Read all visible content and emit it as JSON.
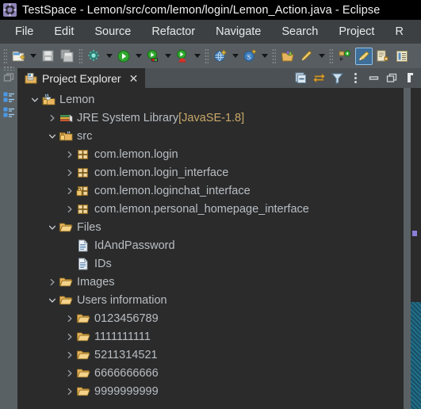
{
  "window": {
    "title": "TestSpace - Lemon/src/com/lemon/login/Lemon_Action.java - Eclipse",
    "app_icon": "eclipse-icon"
  },
  "menubar": {
    "items": [
      {
        "label": "File"
      },
      {
        "label": "Edit"
      },
      {
        "label": "Source"
      },
      {
        "label": "Refactor"
      },
      {
        "label": "Navigate"
      },
      {
        "label": "Search"
      },
      {
        "label": "Project"
      },
      {
        "label": "R"
      }
    ]
  },
  "toolbar": {
    "groups": [
      {
        "buttons": [
          {
            "icon": "new-wizard-icon",
            "dropdown": true
          },
          {
            "icon": "save-icon",
            "dropdown": false
          },
          {
            "icon": "save-all-icon",
            "dropdown": false
          }
        ]
      },
      {
        "buttons": [
          {
            "icon": "new-java-class-icon",
            "dropdown": true
          },
          {
            "icon": "run-icon",
            "dropdown": true
          },
          {
            "icon": "debug-icon",
            "dropdown": true
          },
          {
            "icon": "run-external-tools-icon",
            "dropdown": true
          }
        ]
      },
      {
        "buttons": [
          {
            "icon": "open-web-browser-icon",
            "dropdown": true
          },
          {
            "icon": "search-icon",
            "dropdown": true
          }
        ]
      },
      {
        "buttons": [
          {
            "icon": "open-type-icon",
            "dropdown": false
          },
          {
            "icon": "edit-icon",
            "dropdown": true
          }
        ]
      },
      {
        "buttons": [
          {
            "icon": "next-annotation-icon",
            "dropdown": false
          },
          {
            "icon": "pencil-highlight-icon",
            "dropdown": false,
            "selected": true
          },
          {
            "icon": "last-edit-location-icon",
            "dropdown": false
          },
          {
            "icon": "outline-icon",
            "dropdown": false
          }
        ]
      }
    ]
  },
  "left_strip": {
    "buttons": [
      {
        "icon": "restore-view-icon"
      },
      {
        "icon": "project-explorer-fastview-icon"
      },
      {
        "icon": "project-explorer-fastview-icon-2"
      }
    ]
  },
  "panel": {
    "tab": {
      "label": "Project Explorer",
      "icon": "project-explorer-icon",
      "close_label": "✕",
      "active": true
    },
    "view_toolbar": [
      {
        "icon": "collapse-all-icon"
      },
      {
        "icon": "link-with-editor-icon"
      },
      {
        "icon": "filter-icon"
      },
      {
        "icon": "view-menu-icon"
      },
      {
        "icon": "minimize-icon"
      },
      {
        "icon": "maximize-icon"
      }
    ]
  },
  "tree": {
    "rows": [
      {
        "depth": 0,
        "state": "expanded",
        "icon": "java-project-icon",
        "label": "Lemon",
        "suffix": ""
      },
      {
        "depth": 1,
        "state": "collapsed",
        "icon": "jre-library-icon",
        "label": "JRE System Library ",
        "suffix": "[JavaSE-1.8]"
      },
      {
        "depth": 1,
        "state": "expanded",
        "icon": "source-folder-icon",
        "label": "src",
        "suffix": ""
      },
      {
        "depth": 2,
        "state": "collapsed",
        "icon": "package-icon",
        "label": "com.lemon.login",
        "suffix": ""
      },
      {
        "depth": 2,
        "state": "collapsed",
        "icon": "package-icon",
        "label": "com.lemon.login_interface",
        "suffix": ""
      },
      {
        "depth": 2,
        "state": "collapsed",
        "icon": "package-locked-icon",
        "label": "com.lemon.loginchat_interface",
        "suffix": ""
      },
      {
        "depth": 2,
        "state": "collapsed",
        "icon": "package-icon",
        "label": "com.lemon.personal_homepage_interface",
        "suffix": ""
      },
      {
        "depth": 1,
        "state": "expanded",
        "icon": "folder-open-icon",
        "label": "Files",
        "suffix": ""
      },
      {
        "depth": 2,
        "state": "leaf",
        "icon": "file-icon",
        "label": "IdAndPassword",
        "suffix": ""
      },
      {
        "depth": 2,
        "state": "leaf",
        "icon": "file-icon",
        "label": "IDs",
        "suffix": ""
      },
      {
        "depth": 1,
        "state": "collapsed",
        "icon": "folder-open-icon",
        "label": "Images",
        "suffix": ""
      },
      {
        "depth": 1,
        "state": "expanded",
        "icon": "folder-open-icon",
        "label": "Users information",
        "suffix": ""
      },
      {
        "depth": 2,
        "state": "collapsed",
        "icon": "folder-open-icon",
        "label": "0123456789",
        "suffix": ""
      },
      {
        "depth": 2,
        "state": "collapsed",
        "icon": "folder-open-icon",
        "label": "1111111111",
        "suffix": ""
      },
      {
        "depth": 2,
        "state": "collapsed",
        "icon": "folder-open-icon",
        "label": "5211314521",
        "suffix": ""
      },
      {
        "depth": 2,
        "state": "collapsed",
        "icon": "folder-open-icon",
        "label": "6666666666",
        "suffix": ""
      },
      {
        "depth": 2,
        "state": "collapsed",
        "icon": "folder-open-icon",
        "label": "9999999999",
        "suffix": ""
      }
    ]
  },
  "colors": {
    "title_bar_bg": "#000000",
    "menu_bar_bg": "#3c4043",
    "toolbar_bg": "#575d61",
    "panel_bg": "#2b2b2b",
    "tab_bar_bg": "#4b5154",
    "tree_text": "#b8bec4",
    "accent_tan": "#c9a96a",
    "folder_gold": "#e3b05a",
    "selection_blue": "#3f6e99"
  }
}
